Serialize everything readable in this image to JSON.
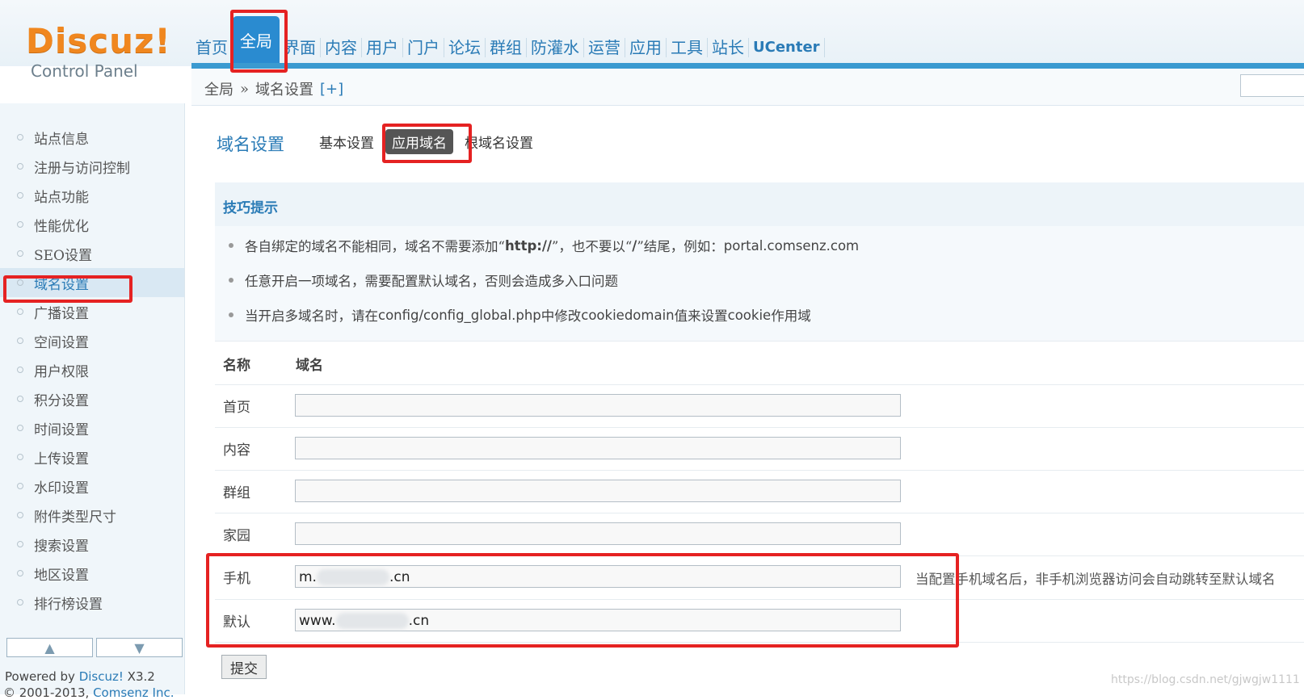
{
  "logo": {
    "title": "Discuz!",
    "subtitle": "Control Panel"
  },
  "nav": {
    "items": [
      "首页",
      "全局",
      "界面",
      "内容",
      "用户",
      "门户",
      "论坛",
      "群组",
      "防灌水",
      "运营",
      "应用",
      "工具",
      "站长",
      "UCenter"
    ],
    "active_index": 1
  },
  "breadcrumb": {
    "section": "全局",
    "sep": "»",
    "page": "域名设置",
    "plus": "[+]"
  },
  "sidebar": {
    "items": [
      "站点信息",
      "注册与访问控制",
      "站点功能",
      "性能优化",
      "SEO设置",
      "域名设置",
      "广播设置",
      "空间设置",
      "用户权限",
      "积分设置",
      "时间设置",
      "上传设置",
      "水印设置",
      "附件类型尺寸",
      "搜索设置",
      "地区设置",
      "排行榜设置"
    ],
    "active_index": 5,
    "up_icon": "arrow-up-icon",
    "down_icon": "arrow-down-icon",
    "powered_prefix": "Powered by ",
    "powered_brand": "Discuz!",
    "powered_version": " X3.2",
    "copyright_text": "© 2001-2013, ",
    "copyright_link": "Comsenz Inc."
  },
  "main": {
    "title": "域名设置",
    "tabs": [
      "基本设置",
      "应用域名",
      "根域名设置"
    ],
    "active_tab": 1,
    "tips": {
      "title": "技巧提示",
      "items": [
        {
          "a": "各自绑定的域名不能相同，域名不需要添加“",
          "b": "http://",
          "c": "”，也不要以“",
          "d": "/",
          "e": "”结尾，例如：",
          "f": "portal.comsenz.com"
        },
        {
          "text": "任意开启一项域名，需要配置默认域名，否则会造成多入口问题"
        },
        {
          "a": "当开启多域名时，请在 ",
          "b": "config/config_global.php",
          "c": " 中修改 ",
          "d": "cookiedomain",
          "e": " 值来设置 ",
          "f": "cookie",
          "g": " 作用域"
        }
      ]
    },
    "table": {
      "col_name": "名称",
      "col_domain": "域名",
      "rows": [
        {
          "label": "首页",
          "value": ""
        },
        {
          "label": "内容",
          "value": ""
        },
        {
          "label": "群组",
          "value": ""
        },
        {
          "label": "家园",
          "value": ""
        },
        {
          "label": "手机",
          "value_prefix": "m.",
          "value_suffix": ".cn"
        },
        {
          "label": "默认",
          "value_prefix": "www.",
          "value_suffix": ".cn"
        }
      ],
      "mobile_hint": "当配置手机域名后，非手机浏览器访问会自动跳转至默认域名"
    },
    "submit_label": "提交"
  },
  "watermark": "https://blog.csdn.net/gjwgjw1111"
}
